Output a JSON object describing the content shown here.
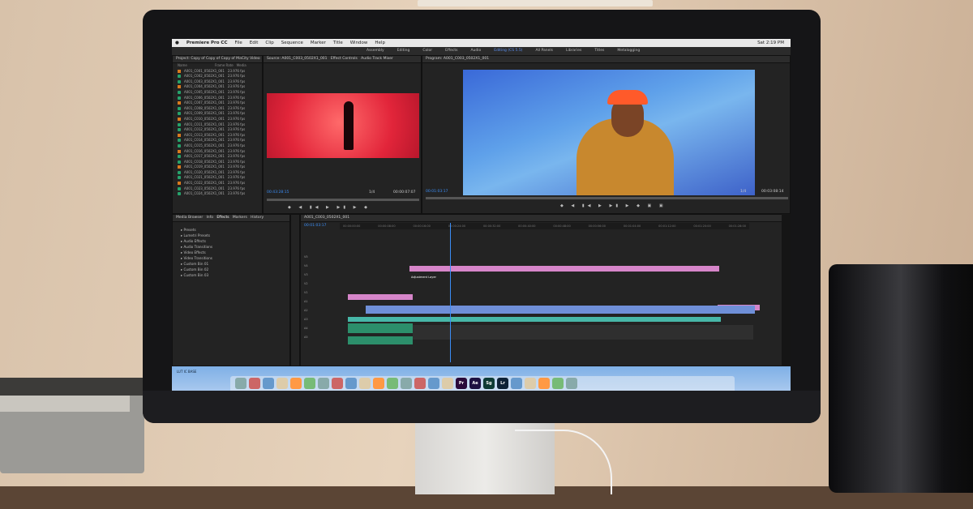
{
  "menubar": {
    "app_name": "Premiere Pro CC",
    "items": [
      "File",
      "Edit",
      "Clip",
      "Sequence",
      "Marker",
      "Title",
      "Window",
      "Help"
    ],
    "clock": "Sat 2:19 PM"
  },
  "workspaces": {
    "tabs": [
      "Assembly",
      "Editing",
      "Color",
      "Effects",
      "Audio",
      "Editing (CS 5.5)",
      "All Panels",
      "Libraries",
      "Titles",
      "Metalogging"
    ],
    "active_index": 5
  },
  "project_panel": {
    "title": "Project: Copy of Copy of Copy of MaCity Video",
    "columns": [
      "Name",
      "Frame Rate",
      "Media"
    ],
    "rows": [
      "A001_C001_0502X1_001",
      "A001_C002_0502X1_001",
      "A001_C003_0502X1_001",
      "A001_C004_0502X1_001",
      "A001_C005_0502X1_001",
      "A001_C006_0502X1_001",
      "A001_C007_0502X1_001",
      "A001_C008_0502X1_001",
      "A001_C009_0502X1_001",
      "A001_C010_0502X1_001",
      "A001_C011_0502X1_001",
      "A001_C012_0502X1_001",
      "A001_C013_0502X1_001",
      "A001_C014_0502X1_001",
      "A001_C015_0502X1_001",
      "A001_C016_0502X1_001",
      "A001_C017_0502X1_001",
      "A001_C018_0502X1_001",
      "A001_C019_0502X1_001",
      "A001_C020_0502X1_001",
      "A001_C021_0502X1_001",
      "A001_C022_0502X1_001",
      "A001_C023_0502X1_001",
      "A001_C024_0502X1_001"
    ],
    "frame_rate": "23.976 fps"
  },
  "source_monitor": {
    "tabs": [
      "Source: A001_C003_0502X1_001",
      "Effect Controls",
      "Audio Track Mixer"
    ],
    "timecode_in": "00:43:28:15",
    "timecode_out": "00:00:07:07",
    "zoom": "1/4"
  },
  "program_monitor": {
    "title": "Program: A001_C003_0502X1_001",
    "timecode_in": "00:01:03:17",
    "timecode_out": "00:03:08:14",
    "zoom": "1/4"
  },
  "effects_panel": {
    "tabs": [
      "Media Browser",
      "Info",
      "Effects",
      "Markers",
      "History"
    ],
    "items": [
      "Presets",
      "Lumetri Presets",
      "Audio Effects",
      "Audio Transitions",
      "Video Effects",
      "Video Transitions",
      "Custom Bin 01",
      "Custom Bin 02",
      "Custom Bin 03"
    ]
  },
  "timeline": {
    "title": "A001_C003_0502X1_001",
    "timecode": "00:01:03:17",
    "ruler_ticks": [
      "00:00:00:00",
      "00:00:08:00",
      "00:00:16:00",
      "00:00:24:00",
      "00:00:32:00",
      "00:00:40:00",
      "00:00:48:00",
      "00:00:56:00",
      "00:01:04:00",
      "00:01:12:00",
      "00:01:20:00",
      "00:01:28:00"
    ],
    "tracks": [
      "V5",
      "V4",
      "V3",
      "V2",
      "V1",
      "A1",
      "A2",
      "A3",
      "A4",
      "A5"
    ],
    "adjustment_label": "Adjustment Layer"
  },
  "status": {
    "label": "LUT IC BASE"
  },
  "dock": {
    "apps": [
      "Finder",
      "Launchpad",
      "Safari",
      "Mail",
      "Contacts",
      "Calendar",
      "Notes",
      "Reminders",
      "Maps",
      "Photos",
      "Messages",
      "FaceTime",
      "iTunes",
      "iBooks",
      "App Store",
      "System Preferences",
      "Pr",
      "Ae",
      "Sg",
      "Lr",
      "Creative Cloud",
      "Chrome",
      "Firefox",
      "Terminal",
      "Trash"
    ],
    "pr_color": "#2a0a3a",
    "ae_color": "#1d1040",
    "sg_color": "#0e3b35",
    "lr_color": "#0e2236"
  }
}
